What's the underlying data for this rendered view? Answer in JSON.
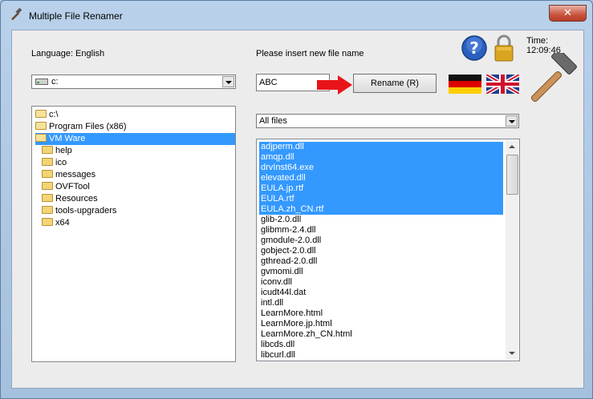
{
  "window": {
    "title": "Multiple File Renamer",
    "close_glyph": "✕"
  },
  "time": {
    "label": "Time: 12:09:46"
  },
  "language": {
    "label": "Language: English"
  },
  "drive": {
    "value": "c:"
  },
  "rename": {
    "prompt": "Please insert new file name",
    "value": "ABC",
    "button_label": "Rename (R)"
  },
  "filter": {
    "value": "All files"
  },
  "tree": {
    "root": "c:\\",
    "level1": "Program Files (x86)",
    "selected": "VM Ware",
    "children": [
      "help",
      "ico",
      "messages",
      "OVFTool",
      "Resources",
      "tools-upgraders",
      "x64"
    ]
  },
  "files": [
    {
      "name": "adjperm.dll",
      "selected": true
    },
    {
      "name": "amqp.dll",
      "selected": true
    },
    {
      "name": "drvInst64.exe",
      "selected": true
    },
    {
      "name": "elevated.dll",
      "selected": true
    },
    {
      "name": "EULA.jp.rtf",
      "selected": true
    },
    {
      "name": "EULA.rtf",
      "selected": true
    },
    {
      "name": "EULA.zh_CN.rtf",
      "selected": true
    },
    {
      "name": "glib-2.0.dll",
      "selected": false
    },
    {
      "name": "glibmm-2.4.dll",
      "selected": false
    },
    {
      "name": "gmodule-2.0.dll",
      "selected": false
    },
    {
      "name": "gobject-2.0.dll",
      "selected": false
    },
    {
      "name": "gthread-2.0.dll",
      "selected": false
    },
    {
      "name": "gvmomi.dll",
      "selected": false
    },
    {
      "name": "iconv.dll",
      "selected": false
    },
    {
      "name": "icudt44l.dat",
      "selected": false
    },
    {
      "name": "intl.dll",
      "selected": false
    },
    {
      "name": "LearnMore.html",
      "selected": false
    },
    {
      "name": "LearnMore.jp.html",
      "selected": false
    },
    {
      "name": "LearnMore.zh_CN.html",
      "selected": false
    },
    {
      "name": "libcds.dll",
      "selected": false
    },
    {
      "name": "libcurl.dll",
      "selected": false
    }
  ],
  "icons": {
    "help": "help-icon",
    "lock": "lock-icon",
    "hammer": "hammer-icon",
    "arrow": "red-arrow-icon",
    "flag_de": "german-flag-icon",
    "flag_uk": "uk-flag-icon"
  },
  "colors": {
    "selection": "#3399ff",
    "arrow": "#e8141a"
  }
}
